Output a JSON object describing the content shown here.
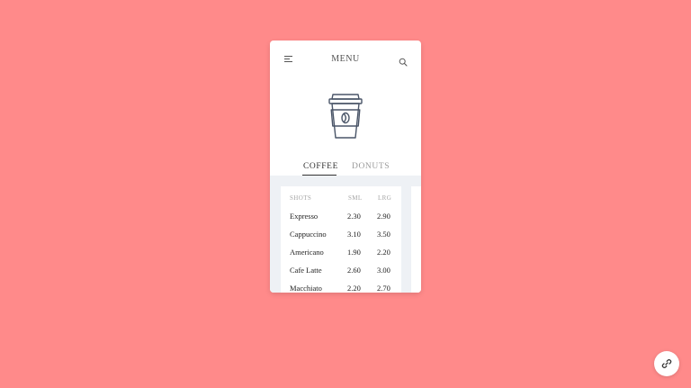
{
  "header": {
    "title": "MENU",
    "menu_icon": "hamburger-icon",
    "search_icon": "search-icon"
  },
  "hero": {
    "icon": "coffee-cup-icon"
  },
  "tabs": [
    {
      "label": "COFFEE",
      "active": true
    },
    {
      "label": "DONUTS",
      "active": false
    }
  ],
  "table": {
    "columns": [
      "SHOTS",
      "SML",
      "LRG"
    ],
    "rows": [
      {
        "name": "Expresso",
        "sml": "2.30",
        "lrg": "2.90"
      },
      {
        "name": "Cappuccino",
        "sml": "3.10",
        "lrg": "3.50"
      },
      {
        "name": "Americano",
        "sml": "1.90",
        "lrg": "2.20"
      },
      {
        "name": "Cafe Latte",
        "sml": "2.60",
        "lrg": "3.00"
      },
      {
        "name": "Macchiato",
        "sml": "2.20",
        "lrg": "2.70"
      }
    ]
  },
  "floating_button": {
    "icon": "link-icon"
  },
  "colors": {
    "background": "#ff8a8a",
    "card": "#ffffff",
    "content_bg": "#eef1f5",
    "text_dark": "#333333",
    "text_muted": "#9a9a9a",
    "icon_stroke": "#4a5568"
  }
}
